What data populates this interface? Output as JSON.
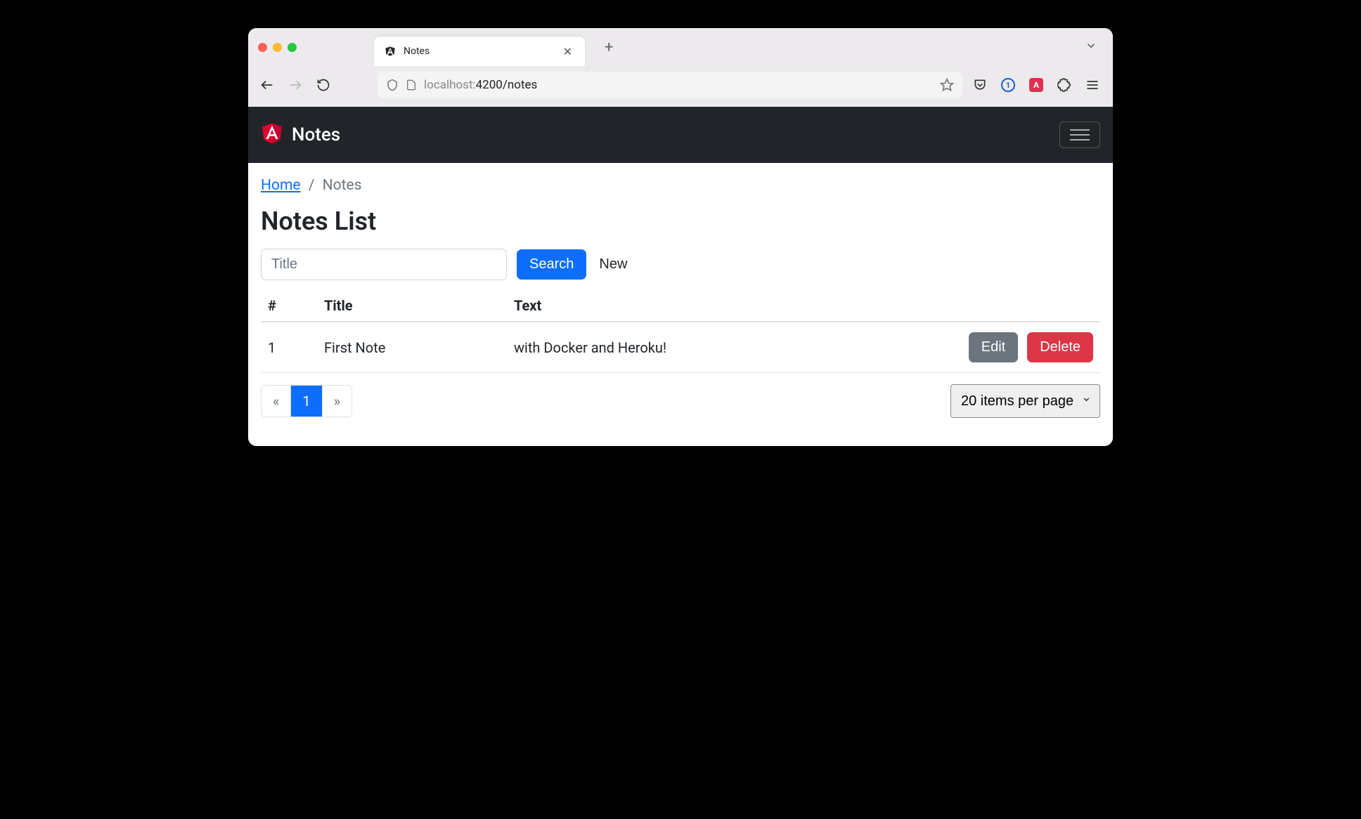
{
  "browser": {
    "tab_title": "Notes",
    "url_muted_prefix": "localhost:",
    "url_rest": "4200/notes"
  },
  "navbar": {
    "brand": "Notes"
  },
  "breadcrumb": {
    "home": "Home",
    "current": "Notes"
  },
  "page": {
    "title": "Notes List"
  },
  "search": {
    "placeholder": "Title",
    "search_label": "Search",
    "new_label": "New"
  },
  "table": {
    "headers": {
      "id": "#",
      "title": "Title",
      "text": "Text"
    },
    "rows": [
      {
        "id": "1",
        "title": "First Note",
        "text": "with Docker and Heroku!"
      }
    ],
    "actions": {
      "edit": "Edit",
      "delete": "Delete"
    }
  },
  "pagination": {
    "prev": "«",
    "pages": [
      "1"
    ],
    "next": "»",
    "page_size_label": "20 items per page"
  }
}
